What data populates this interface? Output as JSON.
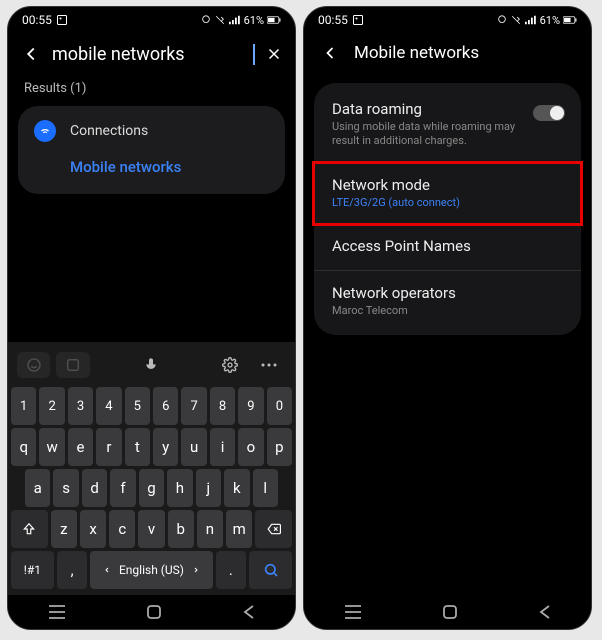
{
  "status": {
    "time": "00:55",
    "battery": "61%"
  },
  "left": {
    "search_value": "mobile networks",
    "results_label": "Results (1)",
    "result_category": "Connections",
    "result_item": "Mobile networks",
    "keyboard": {
      "row_num": [
        "1",
        "2",
        "3",
        "4",
        "5",
        "6",
        "7",
        "8",
        "9",
        "0"
      ],
      "row_q": [
        "q",
        "w",
        "e",
        "r",
        "t",
        "y",
        "u",
        "i",
        "o",
        "p"
      ],
      "row_a": [
        "a",
        "s",
        "d",
        "f",
        "g",
        "h",
        "j",
        "k",
        "l"
      ],
      "row_z": [
        "z",
        "x",
        "c",
        "v",
        "b",
        "n",
        "m"
      ],
      "sym_key": "!#1",
      "comma": ",",
      "space_label": "English (US)",
      "period": "."
    }
  },
  "right": {
    "title": "Mobile networks",
    "items": [
      {
        "title": "Data roaming",
        "sub": "Using mobile data while roaming may result in additional charges.",
        "toggle": true
      },
      {
        "title": "Network mode",
        "sub": "LTE/3G/2G (auto connect)",
        "blue": true,
        "highlight": true
      },
      {
        "title": "Access Point Names",
        "sub": ""
      },
      {
        "title": "Network operators",
        "sub": "Maroc Telecom"
      }
    ]
  }
}
